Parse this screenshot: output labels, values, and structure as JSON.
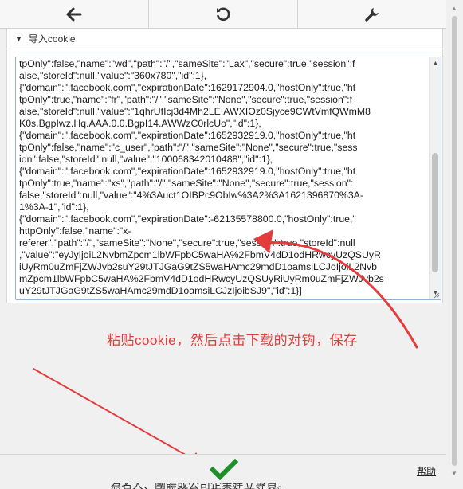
{
  "toolbar": {
    "back_icon": "arrow-left-icon",
    "reset_icon": "rotate-icon",
    "settings_icon": "wrench-icon"
  },
  "section": {
    "title": "导入cookie"
  },
  "cookie_text": {
    "lines": [
      "tpOnly\":false,\"name\":\"wd\",\"path\":\"/\",\"sameSite\":\"Lax\",\"secure\":true,\"session\":f",
      "alse,\"storeId\":null,\"value\":\"360x780\",\"id\":1},",
      "{\"domain\":\".facebook.com\",\"expirationDate\":1629172904.0,\"hostOnly\":true,\"ht",
      "tpOnly\":true,\"name\":\"fr\",\"path\":\"/\",\"sameSite\":\"None\",\"secure\":true,\"session\":f",
      "alse,\"storeId\":null,\"value\":\"1qhrUfIcj3d4Mh2LE.AWXIOz0Sjyce9CWtVmfQWmM8",
      "K0s.BgpIwz.Hq.AAA.0.0.BgpI14.AWWzC0rlcUo\",\"id\":1},",
      "{\"domain\":\".facebook.com\",\"expirationDate\":1652932919.0,\"hostOnly\":true,\"ht",
      "tpOnly\":false,\"name\":\"c_user\",\"path\":\"/\",\"sameSite\":\"None\",\"secure\":true,\"sess",
      "ion\":false,\"storeId\":null,\"value\":\"100068342010488\",\"id\":1},",
      "{\"domain\":\".facebook.com\",\"expirationDate\":1652932919.0,\"hostOnly\":true,\"ht",
      "tpOnly\":true,\"name\":\"xs\",\"path\":\"/\",\"sameSite\":\"None\",\"secure\":true,\"session\":",
      "false,\"storeId\":null,\"value\":\"4%3Auct1OIBPc9ObIw%3A2%3A1621396870%3A-",
      "1%3A-1\",\"id\":1},",
      "{\"domain\":\".facebook.com\",\"expirationDate\":-62135578800.0,\"hostOnly\":true,\"",
      "httpOnly\":false,\"name\":\"x-",
      "referer\",\"path\":\"/\",\"sameSite\":\"None\",\"secure\":true,\"session\":true,\"storeId\":null",
      ",\"value\":\"eyJyIjoiL2NvbmZpcm1lbWFpbC5waHA%2FbmV4dD1odHRwcyUzQSUyR",
      "iUyRm0uZmFjZWJvb2suY29tJTJGaG9tZS5waHAmc29mdD1oamsiLCJoIjoiL2Nvb",
      "mZpcm1lbWFpbC5waHA%2FbmV4dD1odHRwcyUzQSUyRiUyRm0uZmFjZWJvb2s",
      "uY29tJTJGaG9tZS5waHAmc29mdD1oamsiLCJzIjoibSJ9\",\"id\":1}]"
    ]
  },
  "annotation": {
    "text": "粘贴cookie，然后点击下载的对钩，保存",
    "color": "#e43c3c"
  },
  "footer": {
    "ok_icon": "checkmark-icon",
    "help_label": "帮助"
  },
  "background_text": "為名人、團體或公司企業建立專頁。",
  "colors": {
    "accent_check": "#1f8f2c",
    "annotation_red": "#e43c3c"
  }
}
